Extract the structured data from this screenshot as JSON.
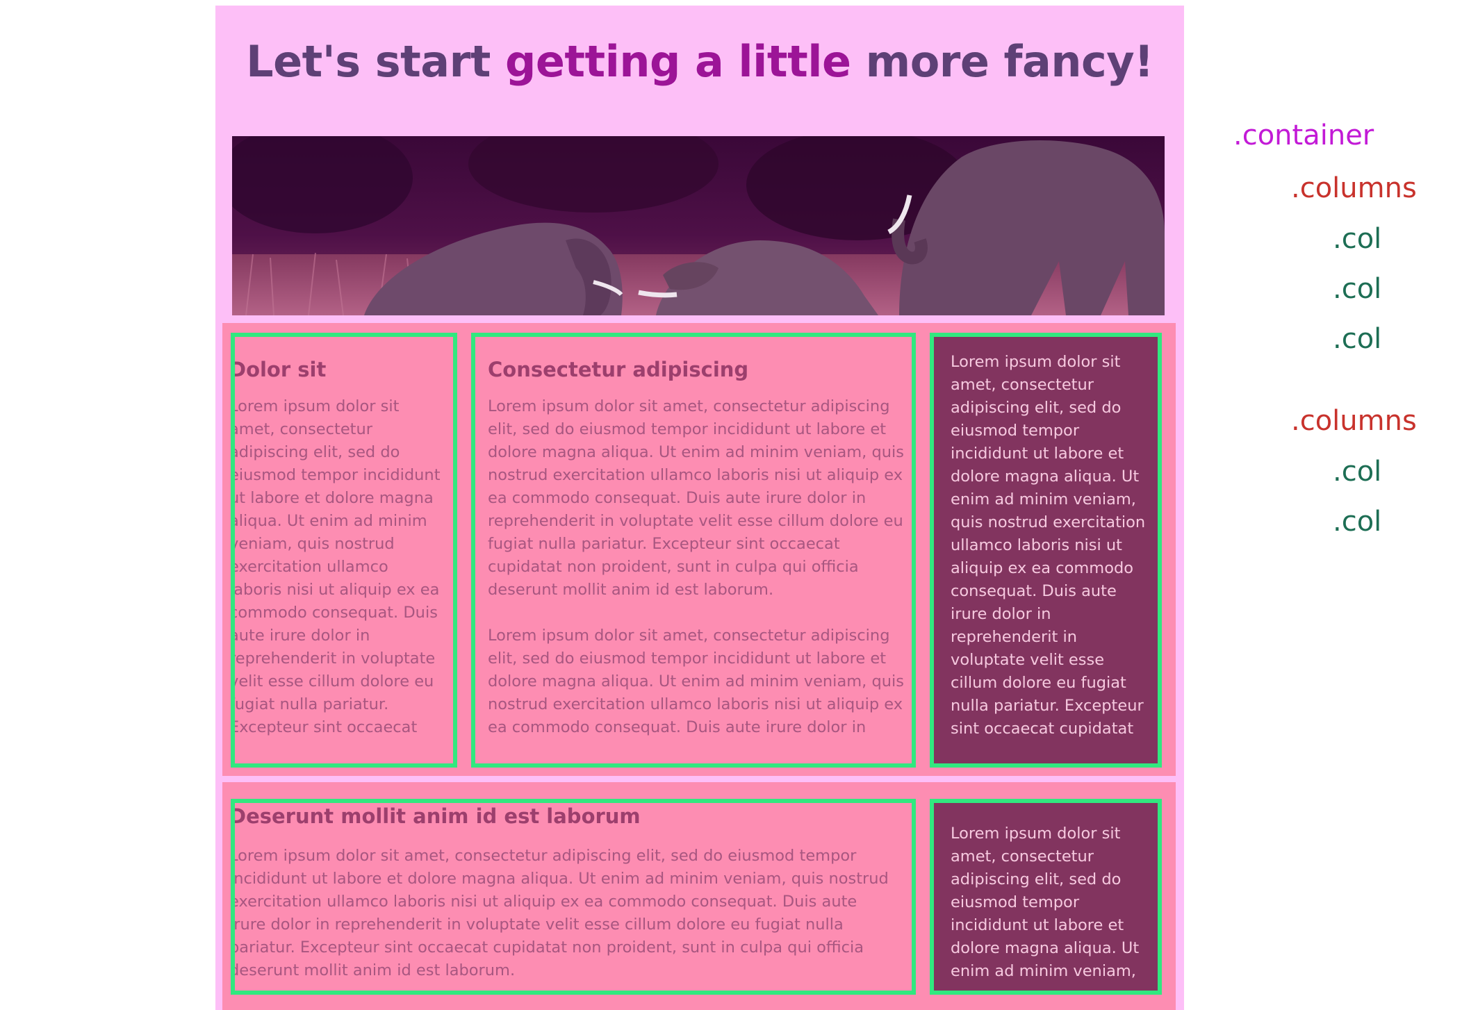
{
  "page": {
    "title_parts": {
      "start": "Let's start ",
      "accent": "getting a little",
      "end": " more fancy!"
    },
    "hero_image": {
      "subject": "elephants"
    }
  },
  "columns_1": {
    "col_1": {
      "heading": "Dolor sit",
      "text": "Lorem ipsum dolor sit amet, consectetur adipiscing elit, sed do eiusmod tempor incididunt ut labore et dolore magna aliqua. Ut enim ad minim veniam, quis nostrud exercitation ullamco laboris nisi ut aliquip ex ea commodo consequat. Duis aute irure dolor in reprehenderit in voluptate velit esse cillum dolore eu fugiat nulla pariatur. Excepteur sint occaecat"
    },
    "col_2": {
      "heading": "Consectetur adipiscing",
      "text_1": "Lorem ipsum dolor sit amet, consectetur adipiscing elit, sed do eiusmod tempor incididunt ut labore et dolore magna aliqua. Ut enim ad minim veniam, quis nostrud exercitation ullamco laboris nisi ut aliquip ex ea commodo consequat. Duis aute irure dolor in reprehenderit in voluptate velit esse cillum dolore eu fugiat nulla pariatur. Excepteur sint occaecat cupidatat non proident, sunt in culpa qui officia deserunt mollit anim id est laborum.",
      "text_2": "Lorem ipsum dolor sit amet, consectetur adipiscing elit, sed do eiusmod tempor incididunt ut labore et dolore magna aliqua. Ut enim ad minim veniam, quis nostrud exercitation ullamco laboris nisi ut aliquip ex ea commodo consequat. Duis aute irure dolor in"
    },
    "col_3": {
      "text": "Lorem ipsum dolor sit amet, consectetur adipiscing elit, sed do eiusmod tempor incididunt ut labore et dolore magna aliqua. Ut enim ad minim veniam, quis nostrud exercitation ullamco laboris nisi ut aliquip ex ea commodo consequat. Duis aute irure dolor in reprehenderit in voluptate velit esse cillum dolore eu fugiat nulla pariatur. Excepteur sint occaecat cupidatat"
    }
  },
  "columns_2": {
    "col_1": {
      "heading": "Deserunt mollit anim id est laborum",
      "text": "Lorem ipsum dolor sit amet, consectetur adipiscing elit, sed do eiusmod tempor incididunt ut labore et dolore magna aliqua. Ut enim ad minim veniam, quis nostrud exercitation ullamco laboris nisi ut aliquip ex ea commodo consequat. Duis aute irure dolor in reprehenderit in voluptate velit esse cillum dolore eu fugiat nulla pariatur. Excepteur sint occaecat cupidatat non proident, sunt in culpa qui officia deserunt mollit anim id est laborum."
    },
    "col_2": {
      "text": "Lorem ipsum dolor sit amet, consectetur adipiscing elit, sed do eiusmod tempor incididunt ut labore et dolore magna aliqua. Ut enim ad minim veniam,"
    }
  },
  "structure_labels": {
    "container": ".container",
    "columns_1": ".columns",
    "col_a": ".col",
    "col_b": ".col",
    "col_c": ".col",
    "columns_2": ".columns",
    "col_d": ".col",
    "col_e": ".col"
  },
  "colors": {
    "container_bg": "#fdbff7",
    "columns_bg": "#fd8db2",
    "col_border": "#31e87f",
    "col_dark_bg": "#82345f",
    "title": "#5e4076",
    "title_accent": "#9c1497",
    "label_container": "#c21ad6",
    "label_columns": "#c8322c",
    "label_col": "#1d6e54"
  }
}
